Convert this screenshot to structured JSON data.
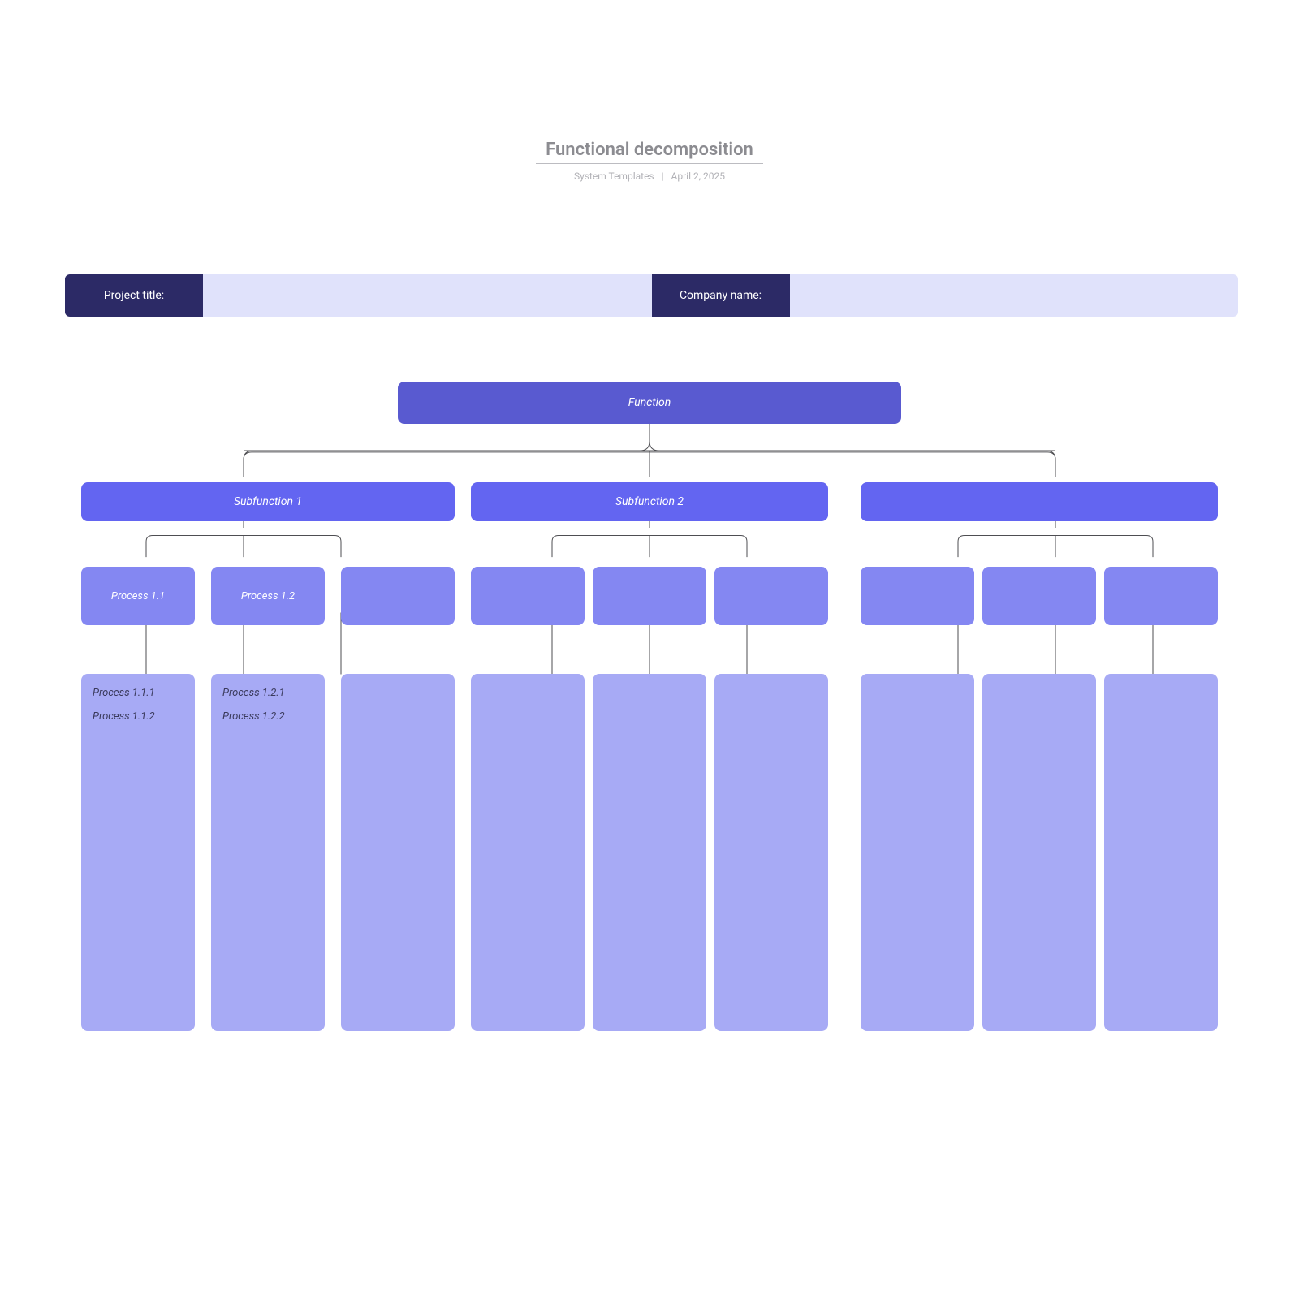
{
  "header": {
    "title": "Functional decomposition",
    "source": "System Templates",
    "date": "April 2, 2025"
  },
  "info": {
    "project_label": "Project title:",
    "company_label": "Company name:"
  },
  "tree": {
    "function": "Function",
    "subfunctions": [
      {
        "label": "Subfunction 1",
        "processes": [
          {
            "label": "Process 1.1",
            "leaves": [
              "Process 1.1.1",
              "Process 1.1.2"
            ]
          },
          {
            "label": "Process 1.2",
            "leaves": [
              "Process 1.2.1",
              "Process 1.2.2"
            ]
          },
          {
            "label": "",
            "leaves": []
          }
        ]
      },
      {
        "label": "Subfunction 2",
        "processes": [
          {
            "label": "",
            "leaves": []
          },
          {
            "label": "",
            "leaves": []
          },
          {
            "label": "",
            "leaves": []
          }
        ]
      },
      {
        "label": "",
        "processes": [
          {
            "label": "",
            "leaves": []
          },
          {
            "label": "",
            "leaves": []
          },
          {
            "label": "",
            "leaves": []
          }
        ]
      }
    ]
  }
}
